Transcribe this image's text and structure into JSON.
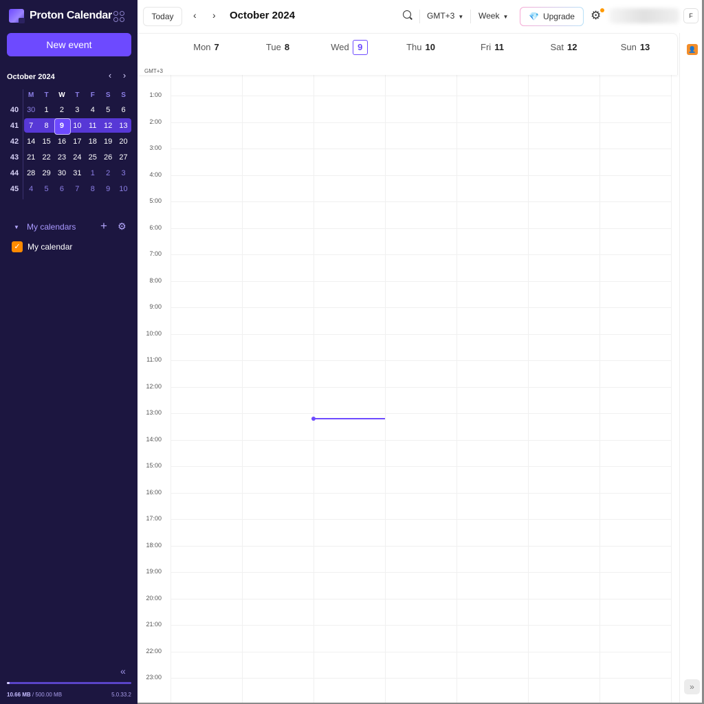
{
  "app": {
    "name": "Proton Calendar",
    "new_event_label": "New event"
  },
  "mini_calendar": {
    "title": "October 2024",
    "dow": [
      "M",
      "T",
      "W",
      "T",
      "F",
      "S",
      "S"
    ],
    "weeks": [
      {
        "wk": "40",
        "days": [
          "30",
          "1",
          "2",
          "3",
          "4",
          "5",
          "6"
        ],
        "out": [
          0
        ]
      },
      {
        "wk": "41",
        "days": [
          "7",
          "8",
          "9",
          "10",
          "11",
          "12",
          "13"
        ],
        "out": [],
        "selected": true,
        "today_index": 2
      },
      {
        "wk": "42",
        "days": [
          "14",
          "15",
          "16",
          "17",
          "18",
          "19",
          "20"
        ],
        "out": []
      },
      {
        "wk": "43",
        "days": [
          "21",
          "22",
          "23",
          "24",
          "25",
          "26",
          "27"
        ],
        "out": []
      },
      {
        "wk": "44",
        "days": [
          "28",
          "29",
          "30",
          "31",
          "1",
          "2",
          "3"
        ],
        "out": [
          4,
          5,
          6
        ]
      },
      {
        "wk": "45",
        "days": [
          "4",
          "5",
          "6",
          "7",
          "8",
          "9",
          "10"
        ],
        "out": [
          0,
          1,
          2,
          3,
          4,
          5,
          6
        ]
      }
    ]
  },
  "calendars": {
    "section_title": "My calendars",
    "items": [
      {
        "name": "My calendar",
        "checked": true,
        "color": "#ff8a00"
      }
    ]
  },
  "storage": {
    "used": "10.66 MB",
    "total": "/ 500.00 MB",
    "fraction": 0.021,
    "version": "5.0.33.2"
  },
  "toolbar": {
    "today_label": "Today",
    "title": "October 2024",
    "timezone": "GMT+3",
    "view": "Week",
    "upgrade_label": "Upgrade",
    "avatar_initial": "F"
  },
  "week": {
    "timezone_label": "GMT+3",
    "days": [
      {
        "dow": "Mon",
        "num": "7"
      },
      {
        "dow": "Tue",
        "num": "8"
      },
      {
        "dow": "Wed",
        "num": "9",
        "today": true
      },
      {
        "dow": "Thu",
        "num": "10"
      },
      {
        "dow": "Fri",
        "num": "11"
      },
      {
        "dow": "Sat",
        "num": "12"
      },
      {
        "dow": "Sun",
        "num": "13"
      }
    ],
    "hours": [
      "1:00",
      "2:00",
      "3:00",
      "4:00",
      "5:00",
      "6:00",
      "7:00",
      "8:00",
      "9:00",
      "10:00",
      "11:00",
      "12:00",
      "13:00",
      "14:00",
      "15:00",
      "16:00",
      "17:00",
      "18:00",
      "19:00",
      "20:00",
      "21:00",
      "22:00",
      "23:00"
    ],
    "current_time": {
      "day_index": 2,
      "hour": 13.2
    }
  },
  "colors": {
    "accent": "#6d4aff",
    "sidebar_bg": "#1c1640",
    "calendar_color": "#ff8a00"
  }
}
